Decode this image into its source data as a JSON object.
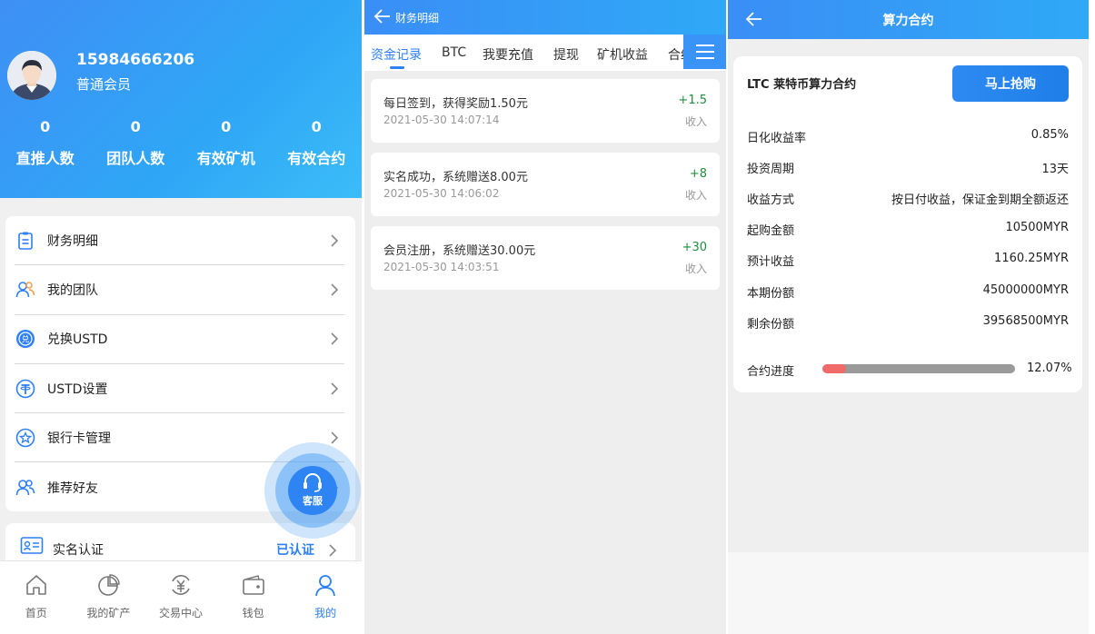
{
  "profile": {
    "phone": "15984666206",
    "level": "普通会员",
    "stats": [
      {
        "value": "0",
        "label": "直推人数"
      },
      {
        "value": "0",
        "label": "团队人数"
      },
      {
        "value": "0",
        "label": "有效矿机"
      },
      {
        "value": "0",
        "label": "有效合约"
      }
    ]
  },
  "menu": [
    {
      "label": "财务明细",
      "icon": "document-list-icon"
    },
    {
      "label": "我的团队",
      "icon": "team-icon"
    },
    {
      "label": "兑换USTD",
      "icon": "exchange-icon"
    },
    {
      "label": "USTD设置",
      "icon": "tether-icon"
    },
    {
      "label": "银行卡管理",
      "icon": "bank-card-icon"
    },
    {
      "label": "推荐好友",
      "icon": "referral-icon"
    }
  ],
  "verification": {
    "label": "实名认证",
    "status": "已认证"
  },
  "customer_service": {
    "label": "客服"
  },
  "tabbar": [
    {
      "label": "首页",
      "icon": "home-icon"
    },
    {
      "label": "我的矿产",
      "icon": "pie-chart-icon"
    },
    {
      "label": "交易中心",
      "icon": "yen-exchange-icon"
    },
    {
      "label": "钱包",
      "icon": "wallet-icon"
    },
    {
      "label": "我的",
      "icon": "user-icon",
      "active": true
    }
  ],
  "finance": {
    "title": "财务明细",
    "tabs": [
      "资金记录",
      "BTC",
      "我要充值",
      "提现",
      "矿机收益",
      "合约"
    ],
    "records": [
      {
        "title": "每日签到，获得奖励1.50元",
        "time": "2021-05-30 14:07:14",
        "amount": "+1.5",
        "type": "收入"
      },
      {
        "title": "实名成功，系统赠送8.00元",
        "time": "2021-05-30 14:06:02",
        "amount": "+8",
        "type": "收入"
      },
      {
        "title": "会员注册，系统赠送30.00元",
        "time": "2021-05-30 14:03:51",
        "amount": "+30",
        "type": "收入"
      }
    ]
  },
  "contract": {
    "title": "算力合约",
    "name": "LTC 莱特币算力合约",
    "buy_label": "马上抢购",
    "rows": [
      {
        "key": "日化收益率",
        "value": "0.85%"
      },
      {
        "key": "投资周期",
        "value": "13天"
      },
      {
        "key": "收益方式",
        "value": "按日付收益，保证金到期全额返还"
      },
      {
        "key": "起购金额",
        "value": "10500MYR"
      },
      {
        "key": "预计收益",
        "value": "1160.25MYR"
      },
      {
        "key": "本期份额",
        "value": "45000000MYR"
      },
      {
        "key": "剩余份额",
        "value": "39568500MYR"
      }
    ],
    "progress_label": "合约进度",
    "progress_text": "12.07%",
    "progress_fraction": 0.1207
  },
  "colors": {
    "accent": "#2d7ff5",
    "income": "#1e8e3e",
    "progress": "#f06a6a"
  }
}
